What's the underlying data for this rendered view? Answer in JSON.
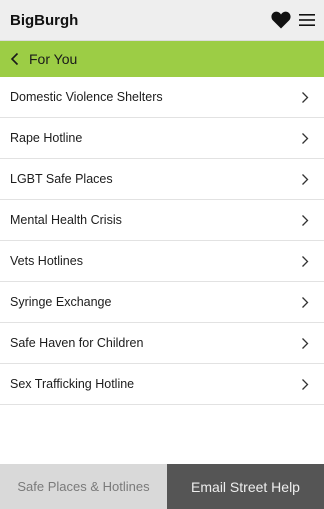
{
  "header": {
    "title": "BigBurgh"
  },
  "subbar": {
    "label": "For You"
  },
  "list": {
    "items": [
      {
        "label": "Domestic Violence Shelters"
      },
      {
        "label": "Rape Hotline"
      },
      {
        "label": "LGBT Safe Places"
      },
      {
        "label": "Mental Health Crisis"
      },
      {
        "label": "Vets Hotlines"
      },
      {
        "label": "Syringe Exchange"
      },
      {
        "label": "Safe Haven for Children"
      },
      {
        "label": "Sex Trafficking Hotline"
      }
    ]
  },
  "tabs": {
    "left_label": "Safe Places & Hotlines",
    "right_label": "Email Street Help"
  },
  "colors": {
    "accent_green": "#9ccd45",
    "header_bg": "#eeeeee",
    "tab_active_bg": "#555555",
    "tab_inactive_bg": "#d9d9d9"
  }
}
